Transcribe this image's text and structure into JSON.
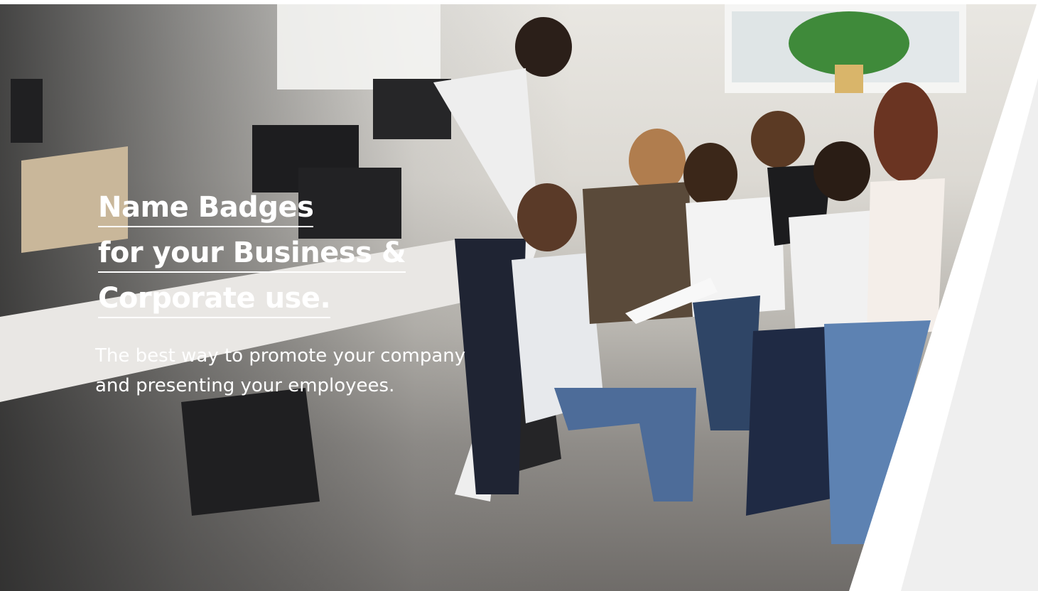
{
  "hero": {
    "headline_lines": [
      "Name Badges",
      "for your Business &",
      "Corporate use."
    ],
    "subtext_lines": [
      "The best way to promote your company",
      "and presenting your employees."
    ],
    "image_description_icon": "office-team-photo"
  },
  "colors": {
    "text": "#ffffff",
    "wedge_white": "#ffffff",
    "wedge_grey": "#efefef"
  }
}
